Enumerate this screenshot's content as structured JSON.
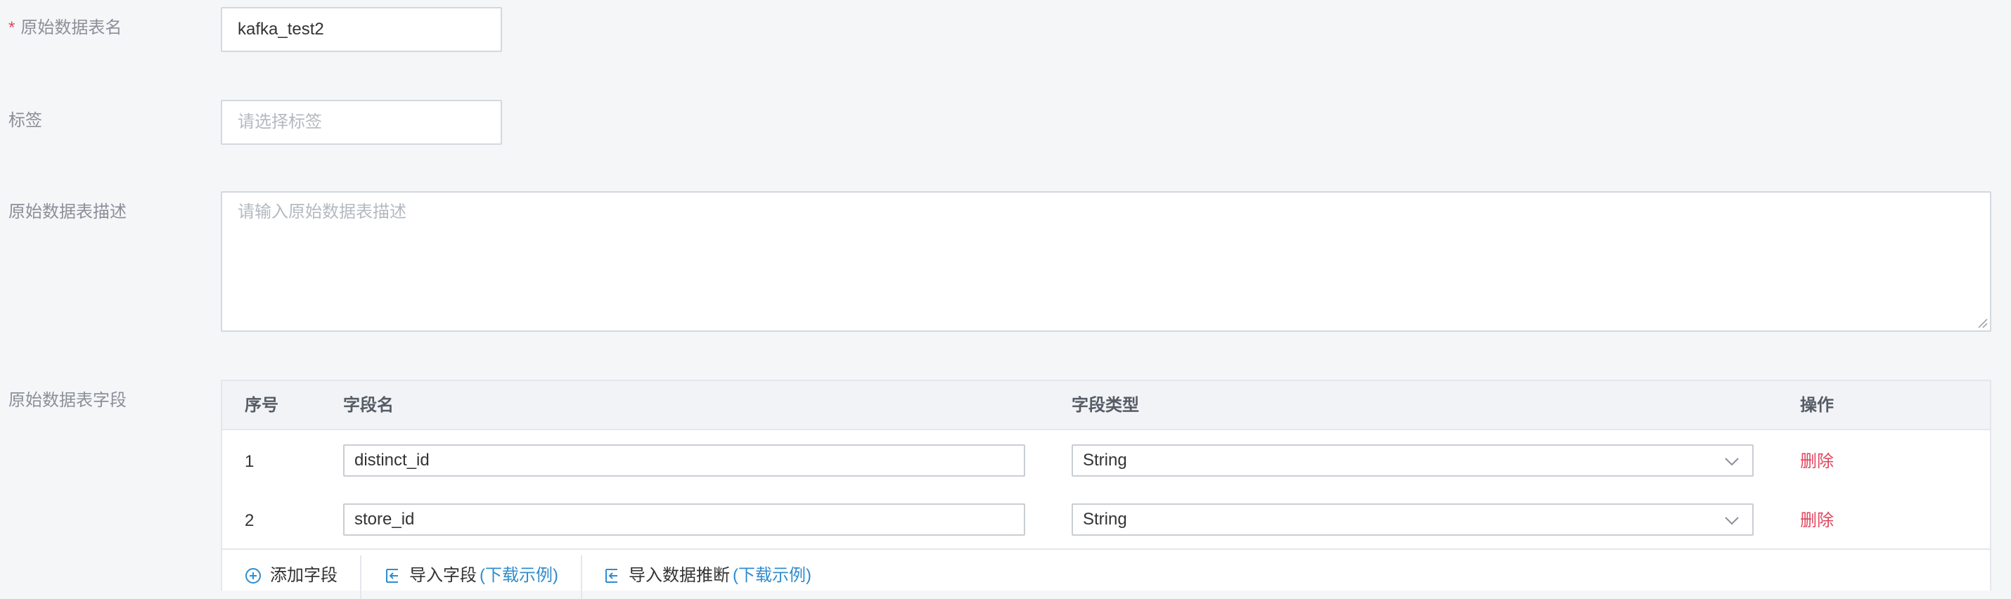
{
  "form": {
    "table_name": {
      "label": "原始数据表名",
      "value": "kafka_test2"
    },
    "tags": {
      "label": "标签",
      "placeholder": "请选择标签"
    },
    "description": {
      "label": "原始数据表描述",
      "placeholder": "请输入原始数据表描述"
    },
    "fields": {
      "label": "原始数据表字段"
    }
  },
  "table": {
    "headers": {
      "index": "序号",
      "name": "字段名",
      "type": "字段类型",
      "action": "操作"
    },
    "rows": [
      {
        "index": "1",
        "name": "distinct_id",
        "type": "String",
        "action": "删除"
      },
      {
        "index": "2",
        "name": "store_id",
        "type": "String",
        "action": "删除"
      }
    ]
  },
  "toolbar": {
    "add_field": "添加字段",
    "import_field": "导入字段",
    "import_field_example": "(下载示例)",
    "import_infer": "导入数据推断",
    "import_infer_example": "(下载示例)"
  },
  "colors": {
    "required": "#e0465e",
    "link": "#2f8ccf",
    "danger": "#e0465e"
  }
}
